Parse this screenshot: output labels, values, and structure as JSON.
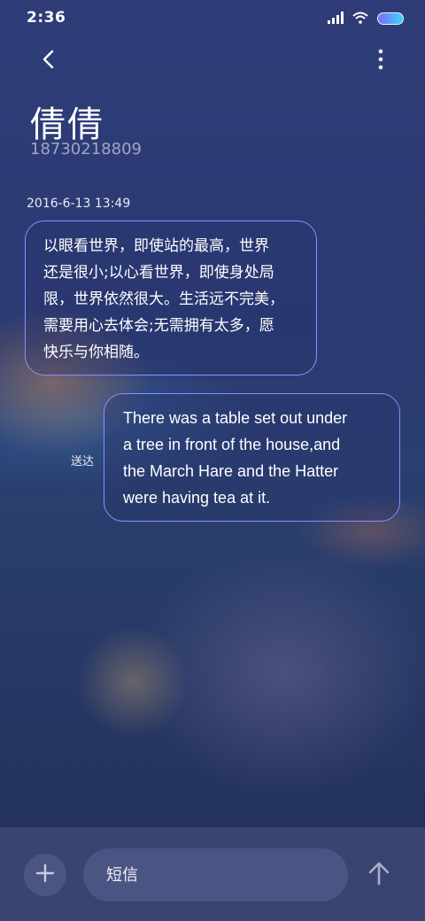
{
  "status_bar": {
    "time": "2:36",
    "battery_colors": [
      "#7b6cff",
      "#38d6f5"
    ]
  },
  "header": {
    "back_icon": "back-arrow-icon",
    "more_icon": "more-vertical-icon",
    "contact_name": "倩倩",
    "contact_phone": "18730218809"
  },
  "conversation": {
    "timestamp": "2016-6-13 13:49",
    "messages": [
      {
        "direction": "incoming",
        "lines": [
          "以眼看世界，即使站的最高，世界",
          "还是很小;以心看世界，即使身处局",
          "限，世界依然很大。生活远不完美，",
          "需要用心去体会;无需拥有太多，愿",
          "快乐与你相随。"
        ]
      },
      {
        "direction": "outgoing",
        "status": "送达",
        "lines": [
          "There was a table set out under",
          "a tree in front of the house,and",
          "the March Hare and the Hatter",
          "were having tea at it."
        ]
      }
    ],
    "bubble_border_color": "#8f8cff"
  },
  "composer": {
    "add_icon": "plus-icon",
    "placeholder": "短信",
    "send_icon": "send-arrow-up-icon"
  }
}
